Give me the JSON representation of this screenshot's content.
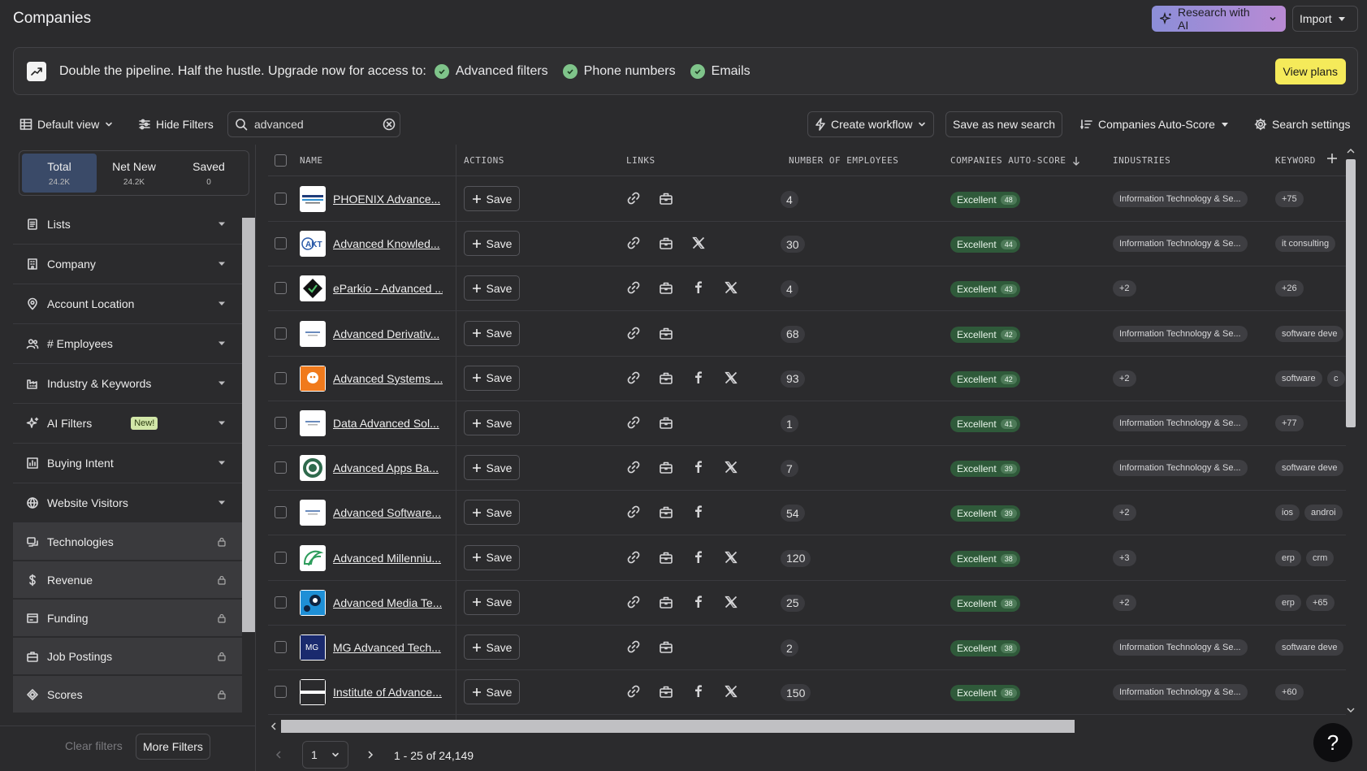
{
  "header": {
    "title": "Companies",
    "research_label": "Research with AI",
    "import_label": "Import"
  },
  "banner": {
    "text": "Double the pipeline. Half the hustle. Upgrade now for access to:",
    "features": [
      "Advanced filters",
      "Phone numbers",
      "Emails"
    ],
    "cta": "View plans"
  },
  "toolbar": {
    "view_label": "Default view",
    "hide_filters_label": "Hide Filters",
    "search_value": "advanced",
    "create_workflow_label": "Create workflow",
    "save_search_label": "Save as new search",
    "sort_label": "Companies Auto-Score",
    "settings_label": "Search settings"
  },
  "segments": [
    {
      "label": "Total",
      "count": "24.2K"
    },
    {
      "label": "Net New",
      "count": "24.2K"
    },
    {
      "label": "Saved",
      "count": "0"
    }
  ],
  "filters": [
    {
      "label": "Lists",
      "icon": "list-icon",
      "locked": false
    },
    {
      "label": "Company",
      "icon": "building-icon",
      "locked": false
    },
    {
      "label": "Account Location",
      "icon": "location-pin-icon",
      "locked": false
    },
    {
      "label": "# Employees",
      "icon": "people-icon",
      "locked": false
    },
    {
      "label": "Industry & Keywords",
      "icon": "factory-icon",
      "locked": false
    },
    {
      "label": "AI Filters",
      "icon": "sparkle-icon",
      "locked": false,
      "badge": "New!"
    },
    {
      "label": "Buying Intent",
      "icon": "bar-chart-icon",
      "locked": false
    },
    {
      "label": "Website Visitors",
      "icon": "globe-icon",
      "locked": false
    },
    {
      "label": "Technologies",
      "icon": "tech-icon",
      "locked": true
    },
    {
      "label": "Revenue",
      "icon": "dollar-icon",
      "locked": true
    },
    {
      "label": "Funding",
      "icon": "funding-icon",
      "locked": true
    },
    {
      "label": "Job Postings",
      "icon": "briefcase-icon",
      "locked": true
    },
    {
      "label": "Scores",
      "icon": "score-icon",
      "locked": true
    }
  ],
  "left_footer": {
    "clear_label": "Clear filters",
    "more_label": "More Filters"
  },
  "columns": [
    "NAME",
    "ACTIONS",
    "LINKS",
    "NUMBER OF EMPLOYEES",
    "COMPANIES AUTO-SCORE",
    "INDUSTRIES",
    "KEYWORD"
  ],
  "save_label": "Save",
  "rows": [
    {
      "name": "PHOENIX Advance...",
      "logo": "phoenix",
      "links": [
        "link",
        "linkedin"
      ],
      "employees": "4",
      "score": "Excellent",
      "score_num": "48",
      "industry": "Information Technology & Se...",
      "keywords": [
        "+75"
      ]
    },
    {
      "name": "Advanced Knowled...",
      "logo": "akt",
      "links": [
        "link",
        "linkedin",
        "x"
      ],
      "employees": "30",
      "score": "Excellent",
      "score_num": "44",
      "industry": "Information Technology & Se...",
      "keywords": [
        "it consulting"
      ]
    },
    {
      "name": "eParkio - Advanced ...",
      "logo": "eparkio",
      "links": [
        "link",
        "linkedin",
        "facebook",
        "x"
      ],
      "employees": "4",
      "score": "Excellent",
      "score_num": "43",
      "industry": "+2",
      "keywords": [
        "+26"
      ]
    },
    {
      "name": "Advanced Derivativ...",
      "logo": "plain",
      "links": [
        "link",
        "linkedin"
      ],
      "employees": "68",
      "score": "Excellent",
      "score_num": "42",
      "industry": "Information Technology & Se...",
      "keywords": [
        "software deve"
      ]
    },
    {
      "name": "Advanced Systems ...",
      "logo": "orange",
      "links": [
        "link",
        "linkedin",
        "facebook",
        "x"
      ],
      "employees": "93",
      "score": "Excellent",
      "score_num": "42",
      "industry": "+2",
      "keywords": [
        "software",
        "c"
      ]
    },
    {
      "name": "Data Advanced Sol...",
      "logo": "plain",
      "links": [
        "link",
        "linkedin"
      ],
      "employees": "1",
      "score": "Excellent",
      "score_num": "41",
      "industry": "Information Technology & Se...",
      "keywords": [
        "+77"
      ]
    },
    {
      "name": "Advanced Apps Ba...",
      "logo": "green-seal",
      "links": [
        "link",
        "linkedin",
        "facebook",
        "x"
      ],
      "employees": "7",
      "score": "Excellent",
      "score_num": "39",
      "industry": "Information Technology & Se...",
      "keywords": [
        "software deve"
      ]
    },
    {
      "name": "Advanced Software...",
      "logo": "plain",
      "links": [
        "link",
        "linkedin",
        "facebook"
      ],
      "employees": "54",
      "score": "Excellent",
      "score_num": "39",
      "industry": "+2",
      "keywords": [
        "ios",
        "androi"
      ]
    },
    {
      "name": "Advanced Millenniu...",
      "logo": "green-swirl",
      "links": [
        "link",
        "linkedin",
        "facebook",
        "x"
      ],
      "employees": "120",
      "score": "Excellent",
      "score_num": "38",
      "industry": "+3",
      "keywords": [
        "erp",
        "crm"
      ]
    },
    {
      "name": "Advanced Media Te...",
      "logo": "blue-face",
      "links": [
        "link",
        "linkedin",
        "facebook",
        "x"
      ],
      "employees": "25",
      "score": "Excellent",
      "score_num": "38",
      "industry": "+2",
      "keywords": [
        "erp",
        "+65"
      ]
    },
    {
      "name": "MG Advanced Tech...",
      "logo": "mg",
      "links": [
        "link",
        "linkedin"
      ],
      "employees": "2",
      "score": "Excellent",
      "score_num": "38",
      "industry": "Information Technology & Se...",
      "keywords": [
        "software deve"
      ]
    },
    {
      "name": "Institute of Advance...",
      "logo": "line",
      "links": [
        "link",
        "linkedin",
        "facebook",
        "x"
      ],
      "employees": "150",
      "score": "Excellent",
      "score_num": "36",
      "industry": "Information Technology & Se...",
      "keywords": [
        "+60"
      ]
    }
  ],
  "pager": {
    "page": "1",
    "range": "1 - 25 of 24,149"
  },
  "help_label": "?",
  "colors": {
    "accent_ai_start": "#8c8ed8",
    "accent_ai_end": "#b98ad4",
    "cta_yellow": "#f5ea5a",
    "score_green": "#2f5a3a",
    "check_green": "#7fc48a",
    "segment_active": "#3a4a68"
  }
}
